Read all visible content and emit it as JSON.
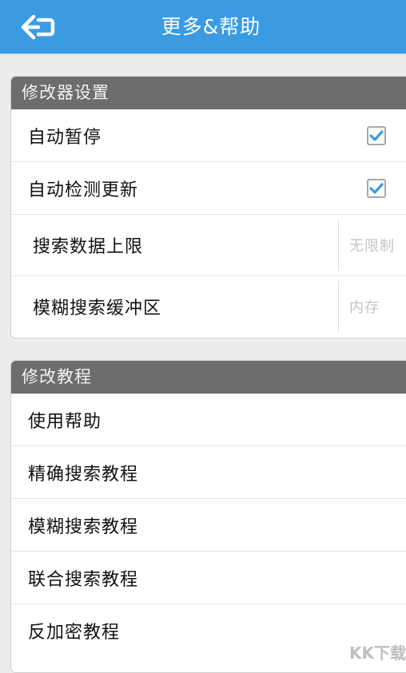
{
  "header": {
    "title": "更多&帮助"
  },
  "settings_section": {
    "title": "修改器设置",
    "items": [
      {
        "label": "自动暂停",
        "checked": true
      },
      {
        "label": "自动检测更新",
        "checked": true
      },
      {
        "label": "搜索数据上限",
        "value": "无限制"
      },
      {
        "label": "模糊搜索缓冲区",
        "value": "内存"
      }
    ]
  },
  "tutorial_section": {
    "title": "修改教程",
    "items": [
      {
        "label": "使用帮助"
      },
      {
        "label": "精确搜索教程"
      },
      {
        "label": "模糊搜索教程"
      },
      {
        "label": "联合搜索教程"
      },
      {
        "label": "反加密教程"
      }
    ]
  },
  "colors": {
    "topbar": "#3a9be3",
    "section_header": "#6d6d6d",
    "background": "#ececec",
    "checkmark": "#3a9be3"
  },
  "watermark": "KK下载"
}
